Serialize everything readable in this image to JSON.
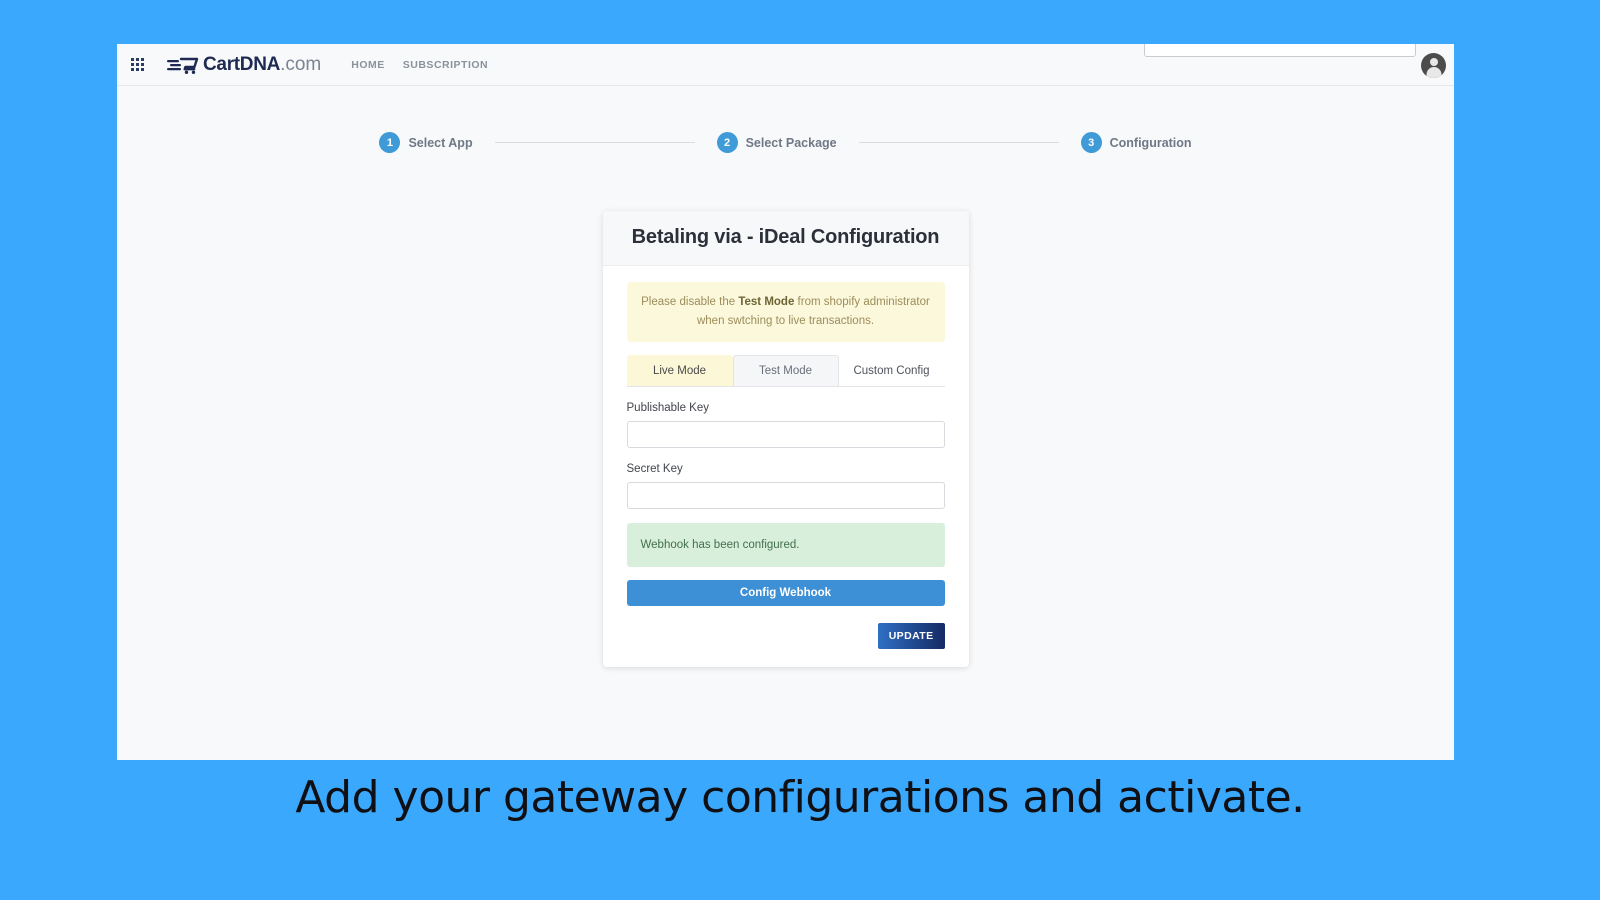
{
  "page": {
    "background_color": "#3aa9fd",
    "caption": "Add your gateway configurations and activate."
  },
  "topbar": {
    "apps_icon": "grid-apps-icon",
    "brand_name": "CartDNA",
    "brand_suffix": ".com",
    "nav_links": [
      {
        "label": "HOME"
      },
      {
        "label": "SUBSCRIPTION"
      }
    ],
    "search_placeholder": "",
    "avatar": "user-avatar"
  },
  "stepper": {
    "steps": [
      {
        "number": "1",
        "label": "Select App"
      },
      {
        "number": "2",
        "label": "Select Package"
      },
      {
        "number": "3",
        "label": "Configuration"
      }
    ],
    "active_color": "#3f9ad8"
  },
  "card": {
    "title": "Betaling via - iDeal Configuration",
    "warning_alert": {
      "text_before": "Please disable the ",
      "text_bold": "Test Mode",
      "text_after": " from shopify administrator when swtching to live transactions.",
      "background_color": "#fcf8dc",
      "text_color": "#9c8d5a"
    },
    "tabs": [
      {
        "label": "Live Mode",
        "state": "active"
      },
      {
        "label": "Test Mode",
        "state": "inactive"
      },
      {
        "label": "Custom Config",
        "state": "plain"
      }
    ],
    "fields": [
      {
        "label": "Publishable Key",
        "value": "",
        "placeholder": ""
      },
      {
        "label": "Secret Key",
        "value": "",
        "placeholder": ""
      }
    ],
    "success_alert": {
      "text": "Webhook has been configured.",
      "background_color": "#d8efdc",
      "text_color": "#44704d"
    },
    "config_webhook_button": {
      "label": "Config Webhook",
      "color": "#3d8fd6"
    },
    "update_button": {
      "label": "UPDATE",
      "gradient_from": "#2f6fc4",
      "gradient_to": "#152a63"
    }
  }
}
